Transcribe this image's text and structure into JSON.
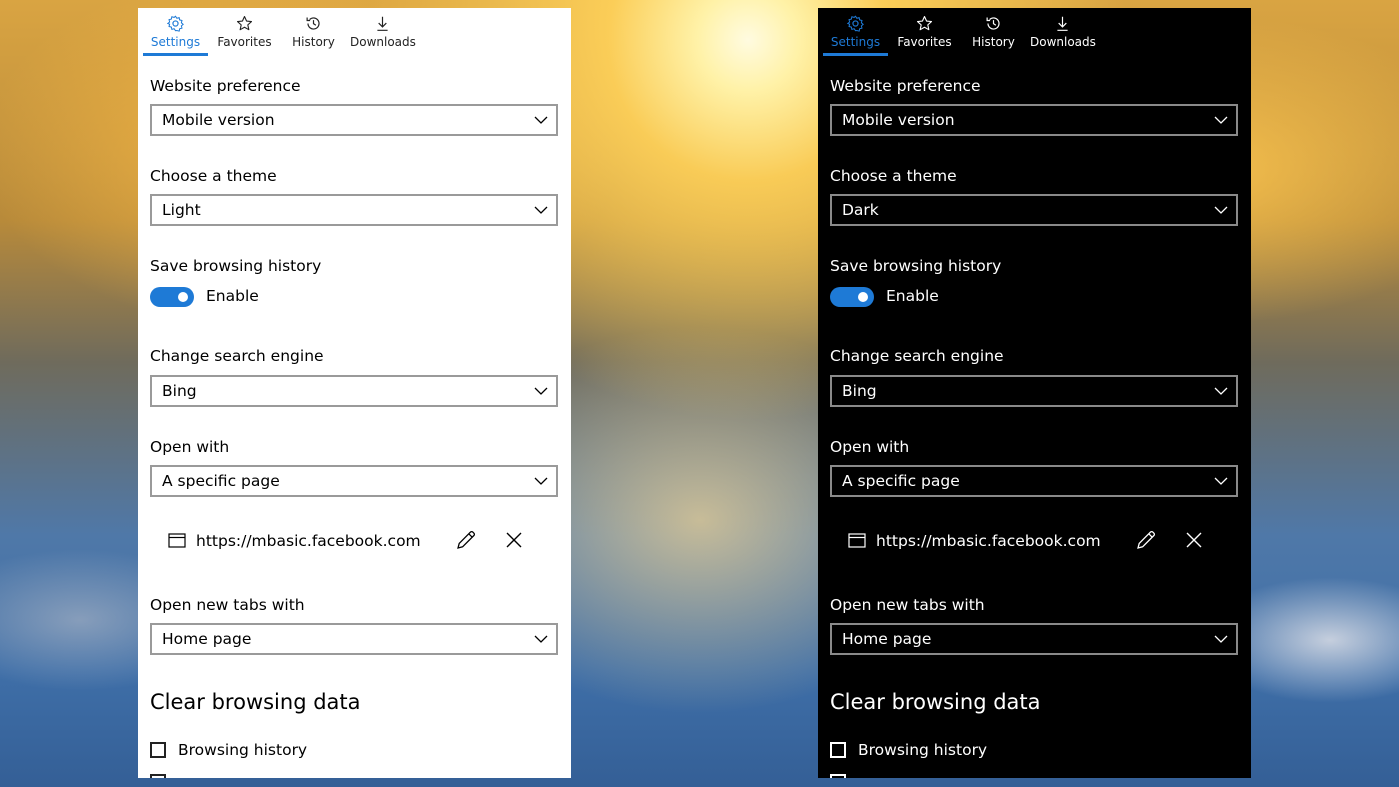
{
  "colors": {
    "accent": "#1e7ad6",
    "light_panel_bg": "#ffffff",
    "dark_panel_bg": "#000000"
  },
  "tabs": [
    {
      "label": "Settings",
      "icon": "gear-icon",
      "active": true
    },
    {
      "label": "Favorites",
      "icon": "star-icon",
      "active": false
    },
    {
      "label": "History",
      "icon": "history-icon",
      "active": false
    },
    {
      "label": "Downloads",
      "icon": "download-icon",
      "active": false
    }
  ],
  "light": {
    "website_preference_label": "Website preference",
    "website_preference_value": "Mobile version",
    "theme_label": "Choose a theme",
    "theme_value": "Light",
    "history_label": "Save browsing history",
    "history_toggle_label": "Enable",
    "search_engine_label": "Change search engine",
    "search_engine_value": "Bing",
    "open_with_label": "Open with",
    "open_with_value": "A specific page",
    "page_url": "https://mbasic.facebook.com",
    "new_tabs_label": "Open new tabs with",
    "new_tabs_value": "Home page",
    "clear_heading": "Clear browsing data",
    "clear_browsing_history": "Browsing history"
  },
  "dark": {
    "website_preference_label": "Website preference",
    "website_preference_value": "Mobile version",
    "theme_label": "Choose a theme",
    "theme_value": "Dark",
    "history_label": "Save browsing history",
    "history_toggle_label": "Enable",
    "search_engine_label": "Change search engine",
    "search_engine_value": "Bing",
    "open_with_label": "Open with",
    "open_with_value": "A specific page",
    "page_url": "https://mbasic.facebook.com",
    "new_tabs_label": "Open new tabs with",
    "new_tabs_value": "Home page",
    "clear_heading": "Clear browsing data",
    "clear_browsing_history": "Browsing history"
  }
}
